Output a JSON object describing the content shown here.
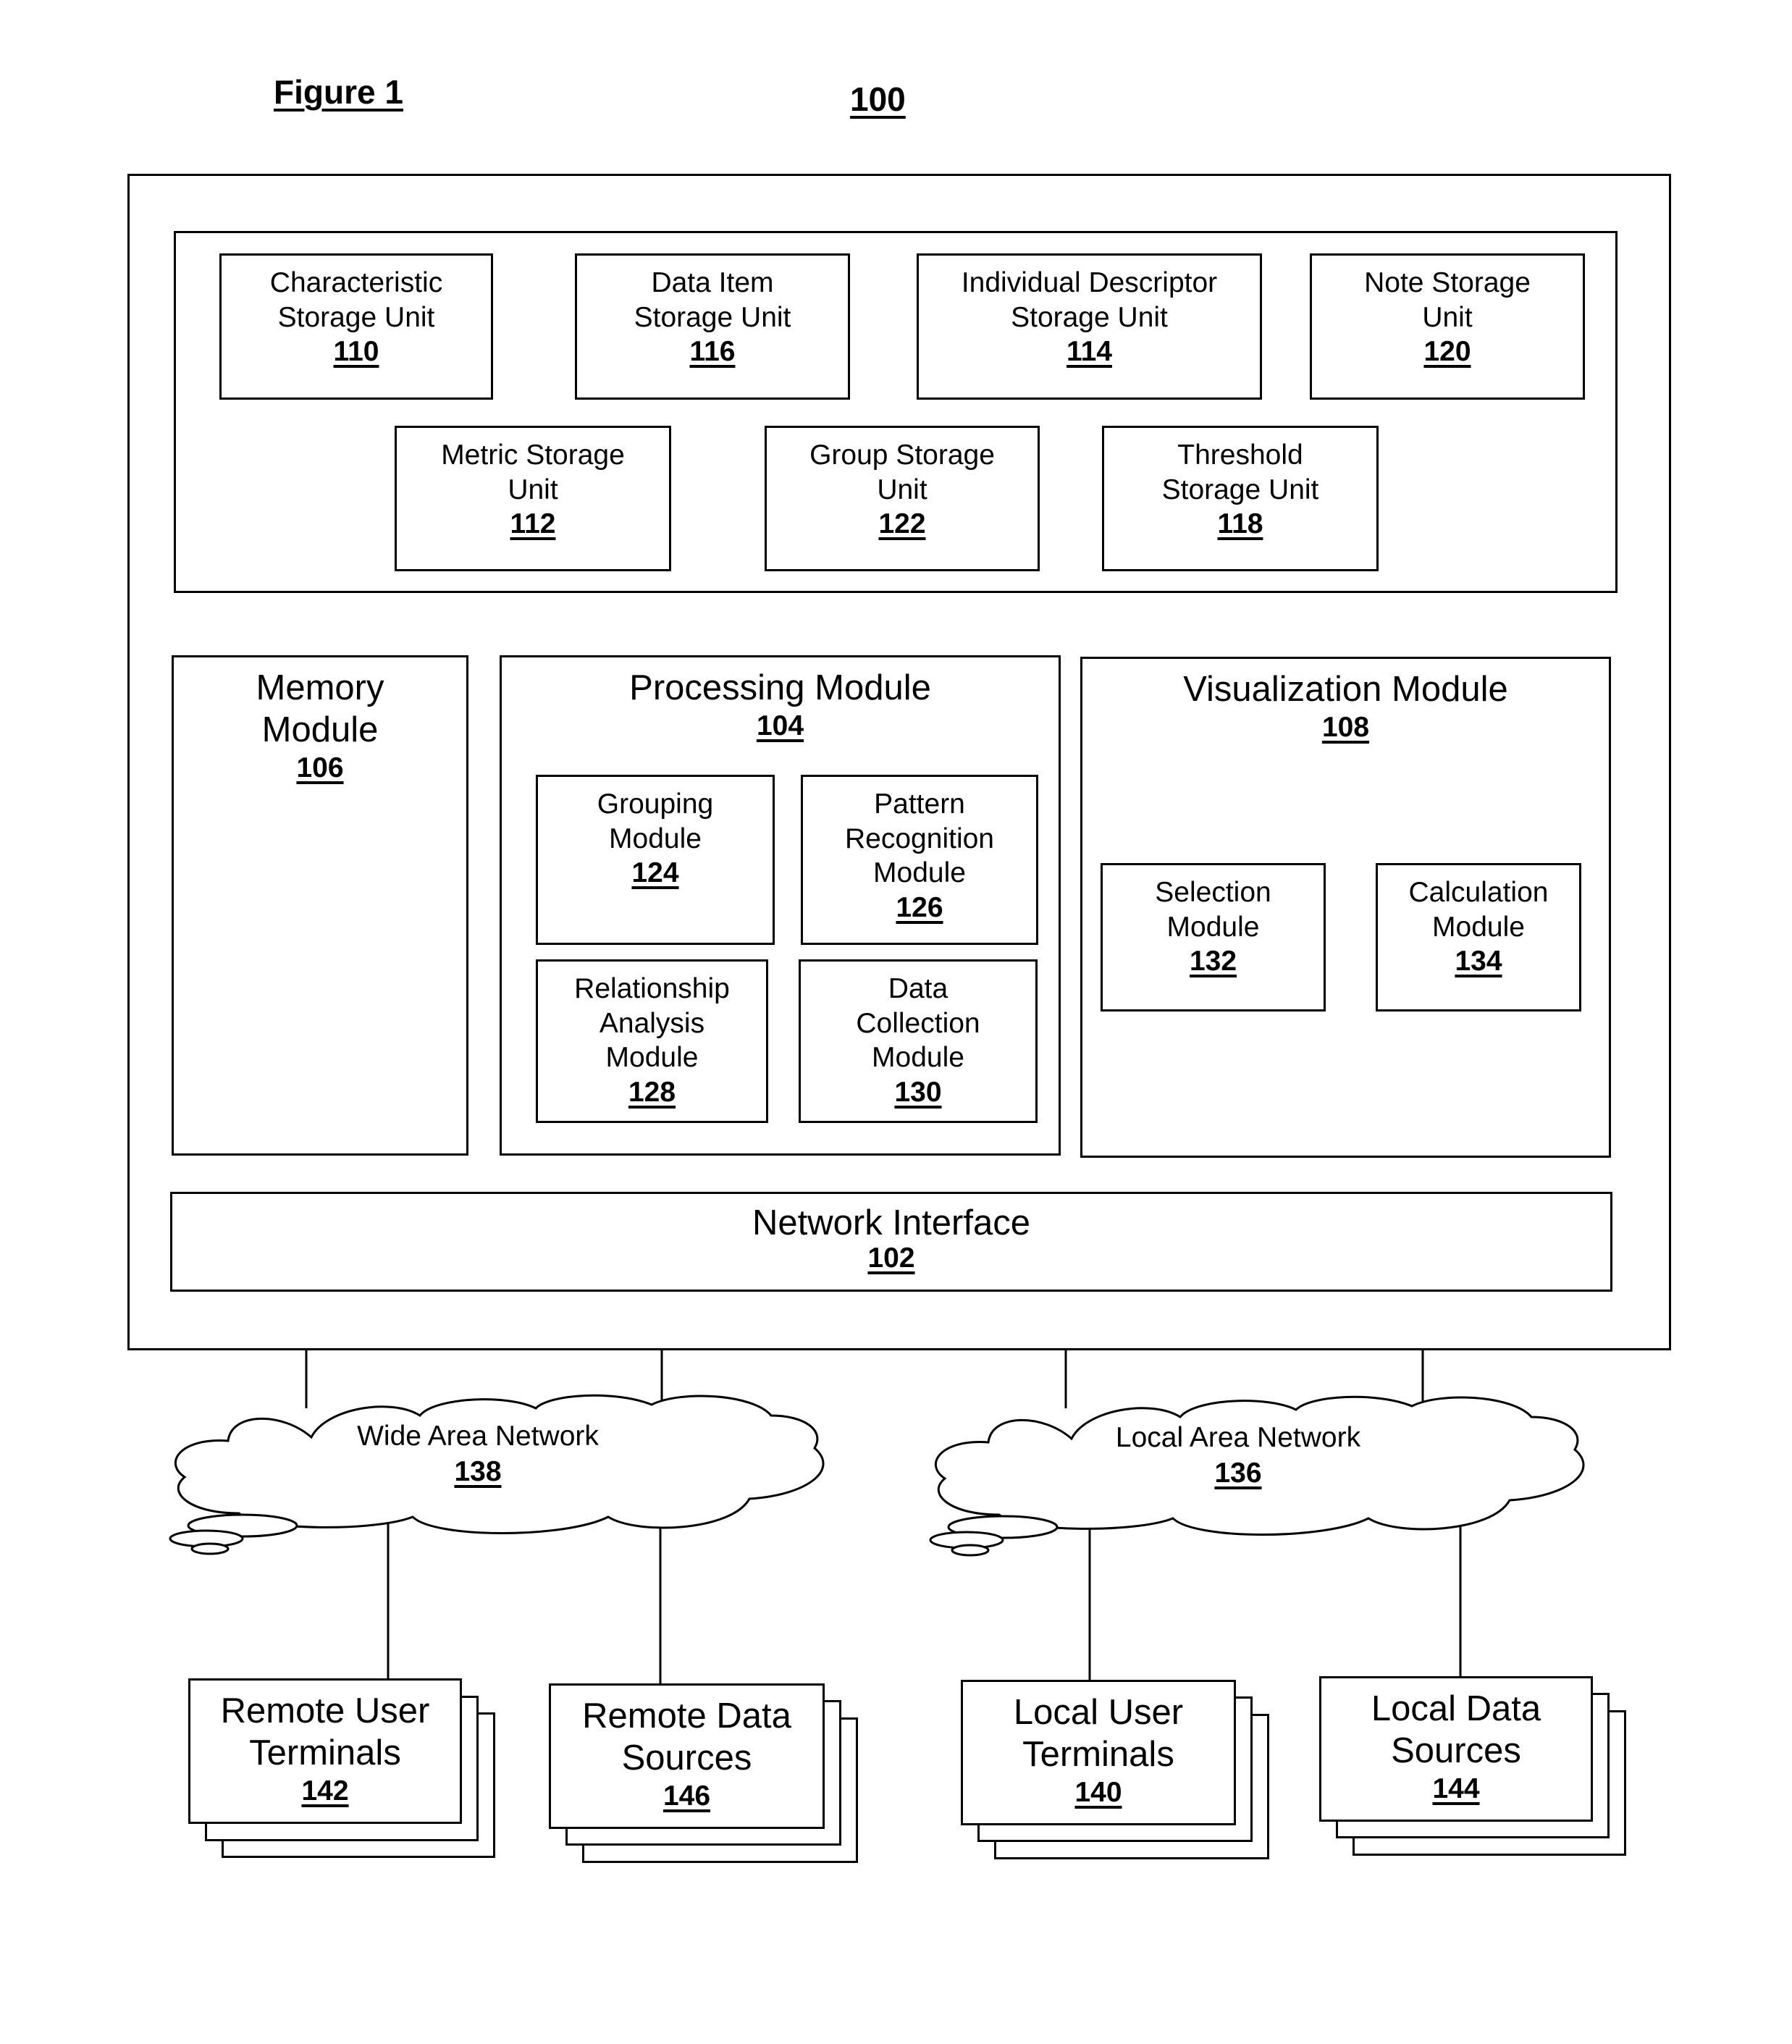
{
  "figure": {
    "title": "Figure 1",
    "system_ref": "100"
  },
  "storage_units": [
    {
      "name": "Characteristic Storage Unit",
      "lines": [
        "Characteristic",
        "Storage Unit"
      ],
      "ref": "110"
    },
    {
      "name": "Data Item Storage Unit",
      "lines": [
        "Data Item",
        "Storage Unit"
      ],
      "ref": "116"
    },
    {
      "name": "Individual Descriptor Storage Unit",
      "lines": [
        "Individual Descriptor",
        "Storage Unit"
      ],
      "ref": "114"
    },
    {
      "name": "Note Storage Unit",
      "lines": [
        "Note Storage",
        "Unit"
      ],
      "ref": "120"
    },
    {
      "name": "Metric Storage Unit",
      "lines": [
        "Metric Storage",
        "Unit"
      ],
      "ref": "112"
    },
    {
      "name": "Group Storage Unit",
      "lines": [
        "Group Storage",
        "Unit"
      ],
      "ref": "122"
    },
    {
      "name": "Threshold Storage Unit",
      "lines": [
        "Threshold",
        "Storage Unit"
      ],
      "ref": "118"
    }
  ],
  "memory_module": {
    "lines": [
      "Memory",
      "Module"
    ],
    "ref": "106"
  },
  "processing_module": {
    "title": "Processing Module",
    "ref": "104",
    "submodules": [
      {
        "lines": [
          "Grouping",
          "Module"
        ],
        "ref": "124"
      },
      {
        "lines": [
          "Pattern",
          "Recognition",
          "Module"
        ],
        "ref": "126"
      },
      {
        "lines": [
          "Relationship",
          "Analysis",
          "Module"
        ],
        "ref": "128"
      },
      {
        "lines": [
          "Data",
          "Collection",
          "Module"
        ],
        "ref": "130"
      }
    ]
  },
  "visualization_module": {
    "title": "Visualization Module",
    "ref": "108",
    "submodules": [
      {
        "lines": [
          "Selection",
          "Module"
        ],
        "ref": "132"
      },
      {
        "lines": [
          "Calculation",
          "Module"
        ],
        "ref": "134"
      }
    ]
  },
  "network_interface": {
    "title": "Network Interface",
    "ref": "102"
  },
  "networks": [
    {
      "title": "Wide Area Network",
      "ref": "138"
    },
    {
      "title": "Local Area Network",
      "ref": "136"
    }
  ],
  "endpoints": [
    {
      "lines": [
        "Remote User",
        "Terminals"
      ],
      "ref": "142"
    },
    {
      "lines": [
        "Remote Data",
        "Sources"
      ],
      "ref": "146"
    },
    {
      "lines": [
        "Local User",
        "Terminals"
      ],
      "ref": "140"
    },
    {
      "lines": [
        "Local Data",
        "Sources"
      ],
      "ref": "144"
    }
  ]
}
